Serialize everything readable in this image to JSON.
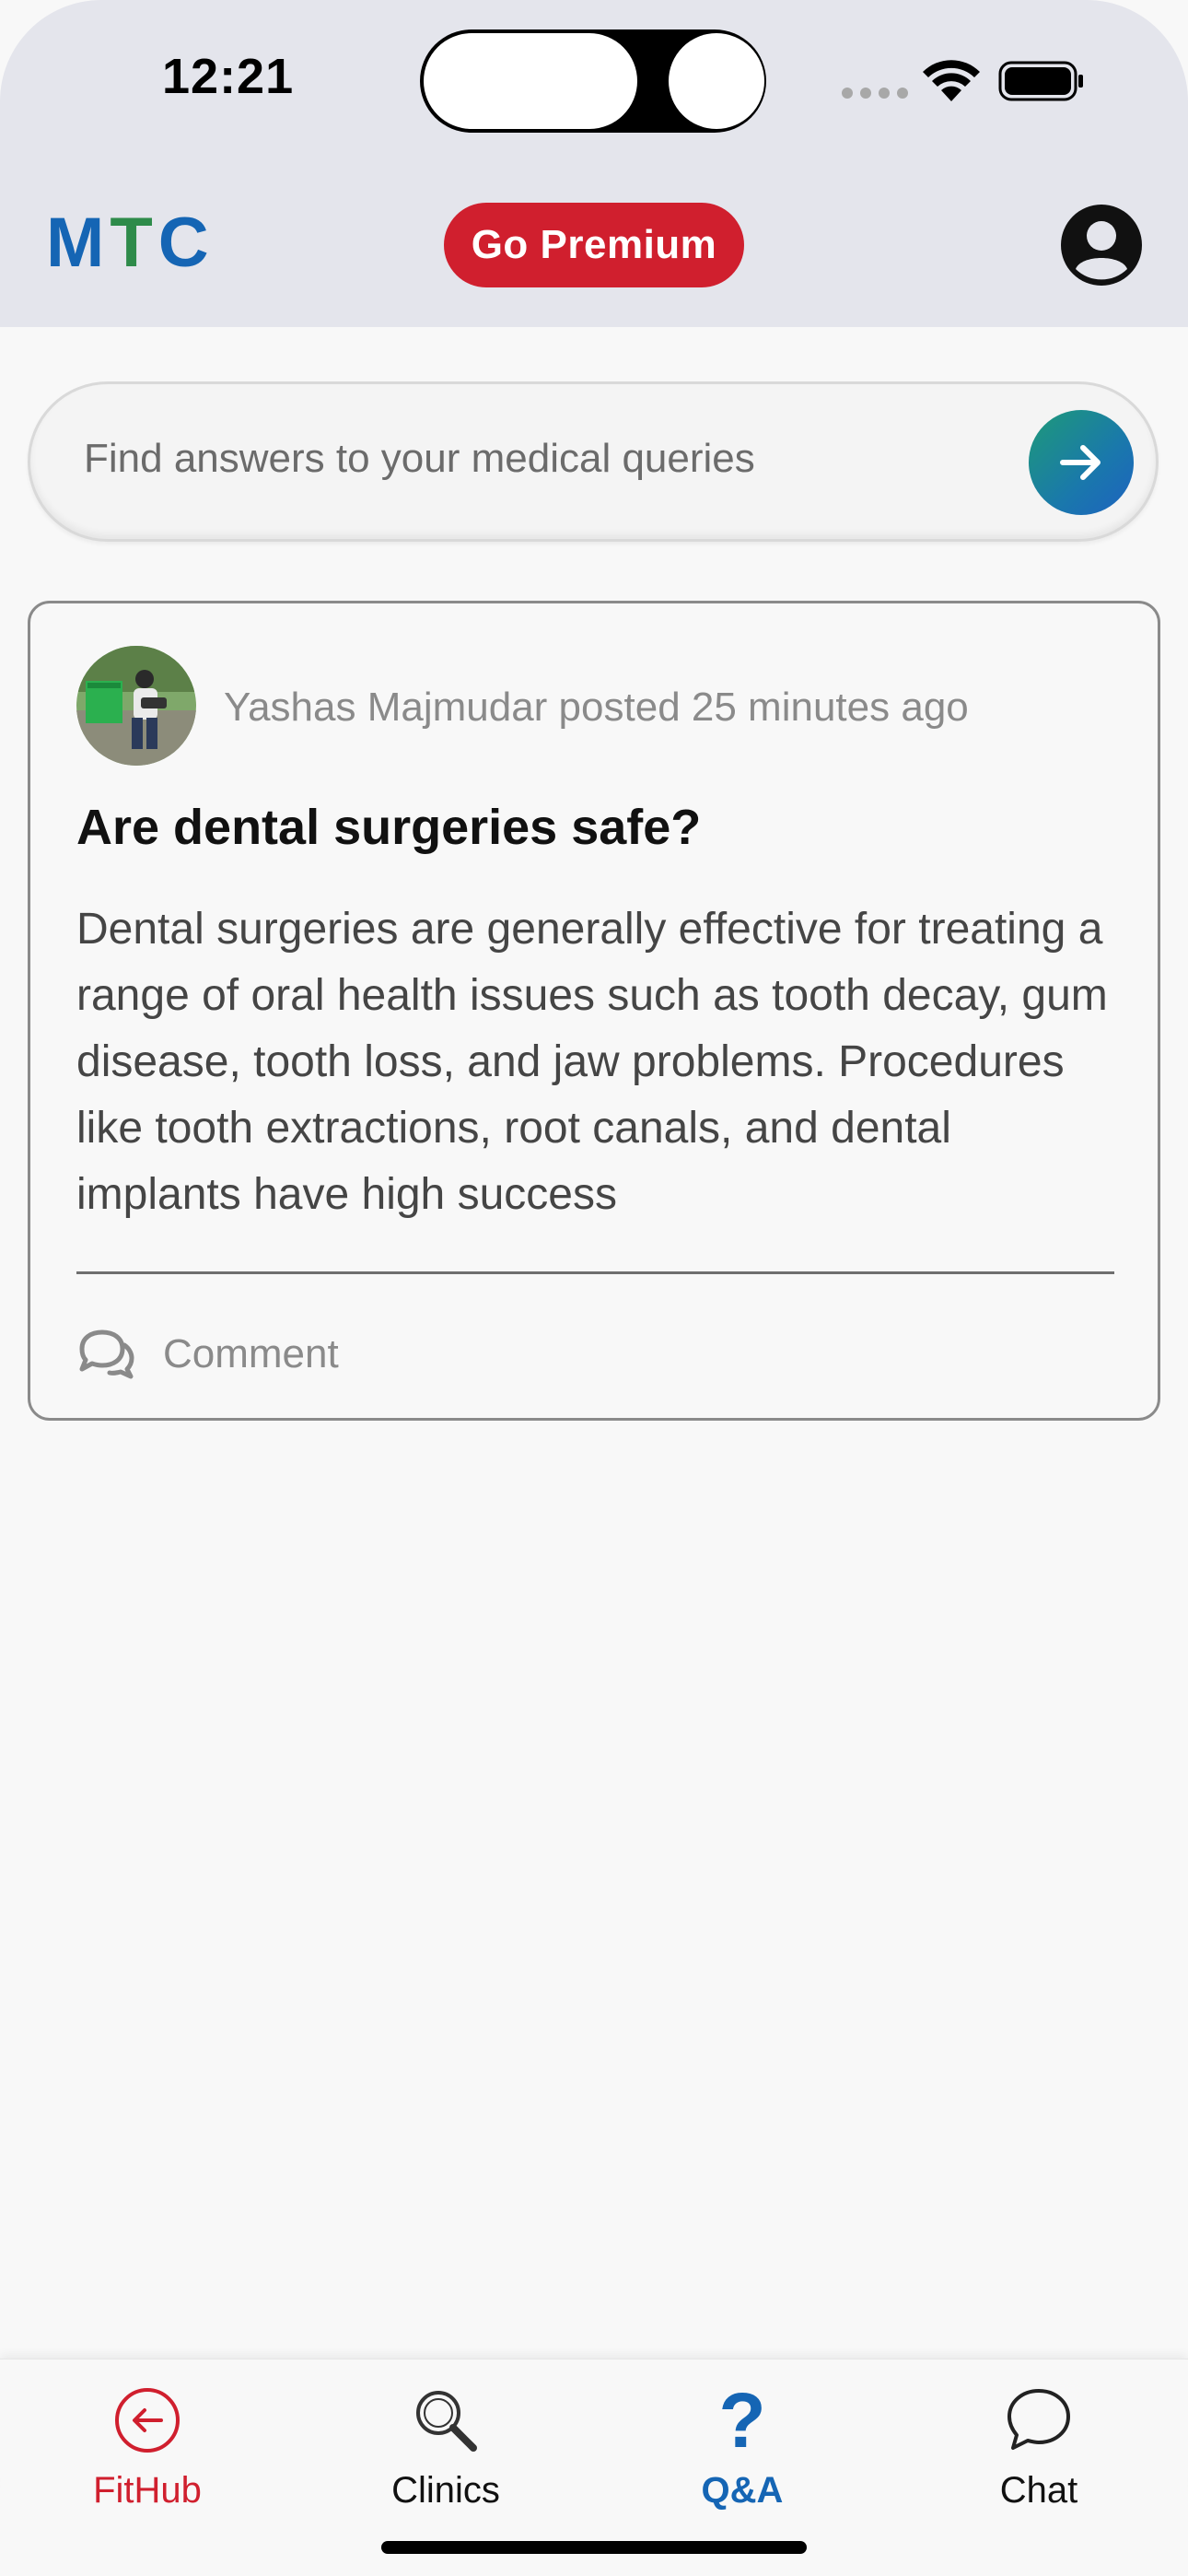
{
  "status_bar": {
    "time": "12:21"
  },
  "header": {
    "brand": {
      "m": "M",
      "t": "T",
      "c": "C"
    },
    "premium_label": "Go Premium",
    "colors": {
      "header_bg": "#e4e5ec",
      "brand_blue": "#1565b4",
      "brand_green": "#2e8b4a",
      "premium_red": "#d01f2e"
    }
  },
  "search": {
    "placeholder": "Find answers to your medical queries",
    "submit_icon": "arrow-right-icon"
  },
  "post": {
    "author": "Yashas Majmudar",
    "meta": "Yashas Majmudar posted 25 minutes ago",
    "title": "Are dental surgeries safe?",
    "body": "Dental surgeries are generally effective for treating a range of oral health issues such as tooth decay, gum disease, tooth loss, and jaw problems. Procedures like tooth extractions, root canals, and dental implants have high success",
    "comment_label": "Comment",
    "comment_icon": "comments-icon"
  },
  "bottom_nav": {
    "items": [
      {
        "label": "FitHub",
        "icon": "back-circle-icon",
        "color": "#d01f2e"
      },
      {
        "label": "Clinics",
        "icon": "search-icon",
        "color": "#111111"
      },
      {
        "label": "Q&A",
        "icon": "question-mark-icon",
        "color": "#1565b4",
        "active": true
      },
      {
        "label": "Chat",
        "icon": "chat-bubble-icon",
        "color": "#111111"
      }
    ]
  }
}
